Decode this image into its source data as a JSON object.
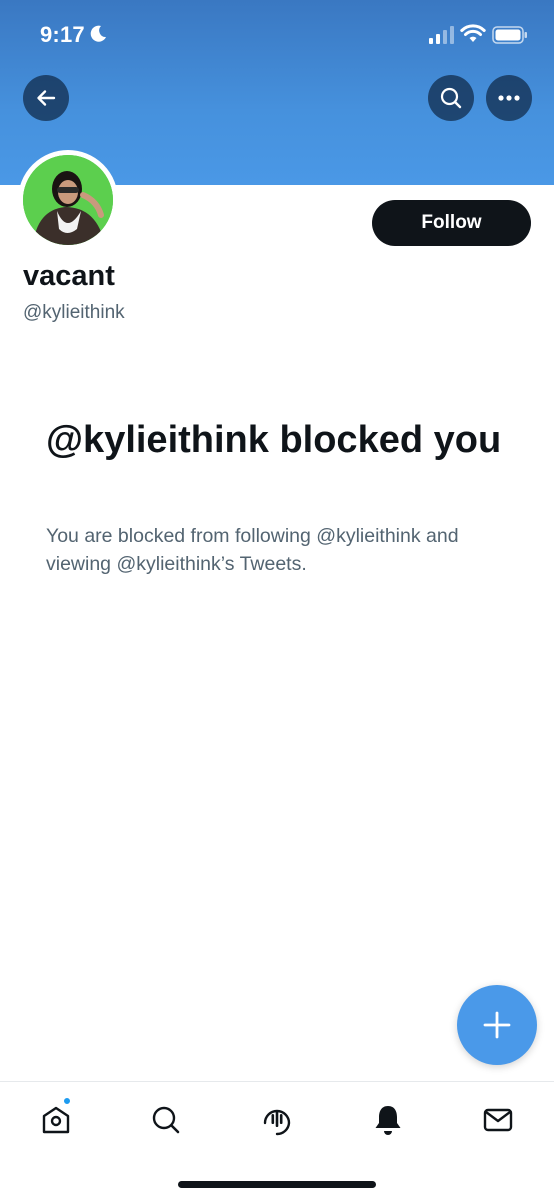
{
  "status_bar": {
    "time": "9:17"
  },
  "profile": {
    "display_name": "vacant",
    "handle": "@kylieithink",
    "follow_label": "Follow"
  },
  "blocked": {
    "title": "@kylieithink blocked you",
    "description": "You are blocked from following @kylieithink and viewing @kylieithink’s Tweets."
  },
  "nav": {
    "top": [
      "back-arrow-icon",
      "search-icon",
      "more-icon"
    ],
    "tabs": [
      "home-icon",
      "search-icon",
      "spaces-icon",
      "notifications-bell-icon",
      "messages-icon"
    ]
  },
  "colors": {
    "banner": "#4691dd",
    "accent": "#4a99e9",
    "follow_button": "#0f1419",
    "secondary_text": "#536471"
  }
}
